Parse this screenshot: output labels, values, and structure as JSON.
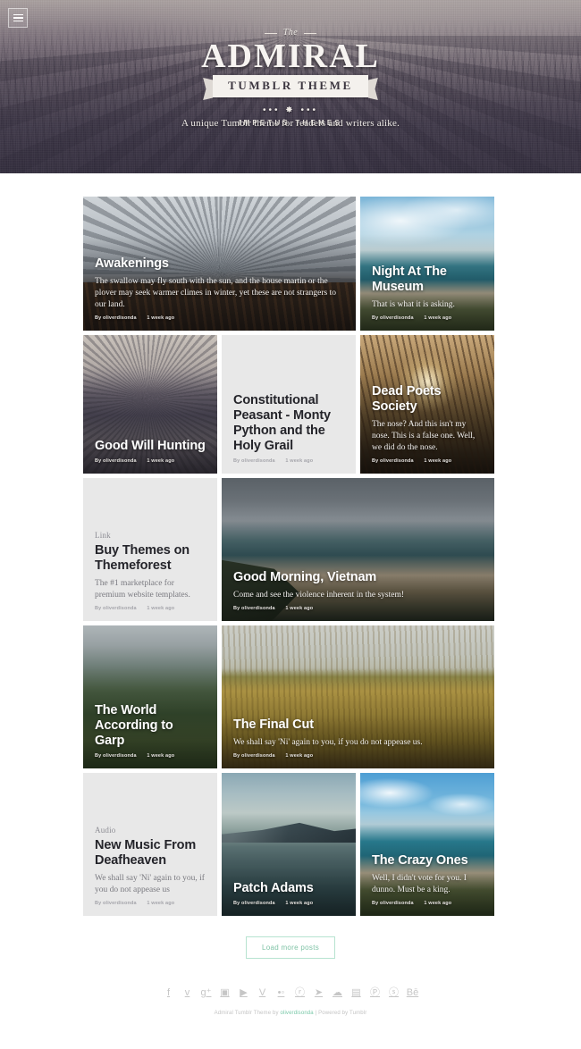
{
  "header": {
    "menu_icon": "hamburger-menu-icon",
    "logo_the": "The",
    "logo_main": "ADMIRAL",
    "logo_ribbon": "TUMBLR THEME",
    "logo_ornament": "•••  ✸  •••",
    "logo_sub": "IMPETUS THEMES",
    "tagline": "A unique Tumblr theme for readers and writers alike."
  },
  "posts": [
    {
      "id": "awakenings",
      "kicker": "",
      "title": "Awakenings",
      "excerpt": "The swallow may fly south with the sun, and the house martin or the plover may seek warmer climes in winter, yet these are not strangers to our land.",
      "author": "By oliverdisonda",
      "time": "1 week ago",
      "theme": "light",
      "photo": "ph-fogforest",
      "width": "w2",
      "height": "h-sm"
    },
    {
      "id": "night-at-the-museum",
      "kicker": "",
      "title": "Night At The Museum",
      "excerpt": "That is what it is asking.",
      "author": "By oliverdisonda",
      "time": "1 week ago",
      "theme": "light",
      "photo": "ph-beach1",
      "width": "w1",
      "height": "h-sm"
    },
    {
      "id": "good-will-hunting",
      "kicker": "",
      "title": "Good Will Hunting",
      "excerpt": "",
      "author": "By oliverdisonda",
      "time": "1 week ago",
      "theme": "light",
      "photo": "ph-lakemono",
      "width": "w1",
      "height": "h-md"
    },
    {
      "id": "constitutional-peasant",
      "kicker": "",
      "title": "Constitutional Peasant - Monty Python and the Holy Grail",
      "excerpt": "",
      "author": "By oliverdisonda",
      "time": "1 week ago",
      "theme": "dark",
      "photo": "",
      "width": "w1",
      "height": "h-md"
    },
    {
      "id": "dead-poets-society",
      "kicker": "",
      "title": "Dead Poets Society",
      "excerpt": "The nose? And this isn't my nose. This is a false one. Well, we did do the nose.",
      "author": "By oliverdisonda",
      "time": "1 week ago",
      "theme": "light",
      "photo": "ph-reeds",
      "width": "w1",
      "height": "h-md"
    },
    {
      "id": "buy-themes-on-themeforest",
      "kicker": "Link",
      "title": "Buy Themes on Themeforest",
      "excerpt": "The #1 marketplace for premium website templates.",
      "author": "By oliverdisonda",
      "time": "1 week ago",
      "theme": "dark",
      "photo": "",
      "width": "w1",
      "height": "h-lg"
    },
    {
      "id": "good-morning-vietnam",
      "kicker": "",
      "title": "Good Morning, Vietnam",
      "excerpt": "Come and see the violence inherent in the system!",
      "author": "By oliverdisonda",
      "time": "1 week ago",
      "theme": "light",
      "photo": "ph-stormcoast",
      "width": "w2",
      "height": "h-lg"
    },
    {
      "id": "the-world-according-to-garp",
      "kicker": "",
      "title": "The World According to Garp",
      "excerpt": "",
      "author": "By oliverdisonda",
      "time": "1 week ago",
      "theme": "light",
      "photo": "ph-greenhill",
      "width": "w1",
      "height": "h-lg"
    },
    {
      "id": "the-final-cut",
      "kicker": "",
      "title": "The Final Cut",
      "excerpt": "We shall say 'Ni' again to you, if you do not appease us.",
      "author": "By oliverdisonda",
      "time": "1 week ago",
      "theme": "light",
      "photo": "ph-wheat",
      "width": "w2",
      "height": "h-lg"
    },
    {
      "id": "new-music-from-deafheaven",
      "kicker": "Audio",
      "title": "New Music From Deafheaven",
      "excerpt": "We shall say 'Ni' again to you, if you do not appease us",
      "author": "By oliverdisonda",
      "time": "1 week ago",
      "theme": "dark",
      "photo": "",
      "width": "w1",
      "height": "h-lg"
    },
    {
      "id": "patch-adams",
      "kicker": "",
      "title": "Patch Adams",
      "excerpt": "",
      "author": "By oliverdisonda",
      "time": "1 week ago",
      "theme": "light",
      "photo": "ph-lakecalm",
      "width": "w1",
      "height": "h-lg"
    },
    {
      "id": "the-crazy-ones",
      "kicker": "",
      "title": "The Crazy Ones",
      "excerpt": "Well, I didn't vote for you. I dunno. Must be a king.",
      "author": "By oliverdisonda",
      "time": "1 week ago",
      "theme": "light",
      "photo": "ph-beach2",
      "width": "w1",
      "height": "h-lg"
    }
  ],
  "load_more": {
    "label": "Load more posts"
  },
  "footer": {
    "social": [
      {
        "name": "facebook-icon",
        "glyph": "f"
      },
      {
        "name": "twitter-icon",
        "glyph": "ᴠ"
      },
      {
        "name": "google-plus-icon",
        "glyph": "g⁺"
      },
      {
        "name": "instagram-icon",
        "glyph": "▣"
      },
      {
        "name": "youtube-icon",
        "glyph": "▶"
      },
      {
        "name": "vimeo-icon",
        "glyph": "V"
      },
      {
        "name": "flickr-icon",
        "glyph": "•◦"
      },
      {
        "name": "behance-circle-icon",
        "glyph": "ⓡ"
      },
      {
        "name": "soundcloud-icon",
        "glyph": "➤"
      },
      {
        "name": "cloud-icon",
        "glyph": "☁"
      },
      {
        "name": "linkedin-icon",
        "glyph": "▤"
      },
      {
        "name": "pinterest-icon",
        "glyph": "Ⓟ"
      },
      {
        "name": "spotify-icon",
        "glyph": "ⓢ"
      },
      {
        "name": "behance-icon",
        "glyph": "Bē"
      }
    ],
    "copyright_pre": "Admiral Tumblr Theme by ",
    "copyright_link": "oliverdisonda",
    "copyright_post": " | Powered by Tumblr"
  },
  "colors": {
    "accent": "#79c8a8",
    "loadmore_border": "#b7e3d0",
    "card_plain_bg": "#e8e8e8"
  }
}
